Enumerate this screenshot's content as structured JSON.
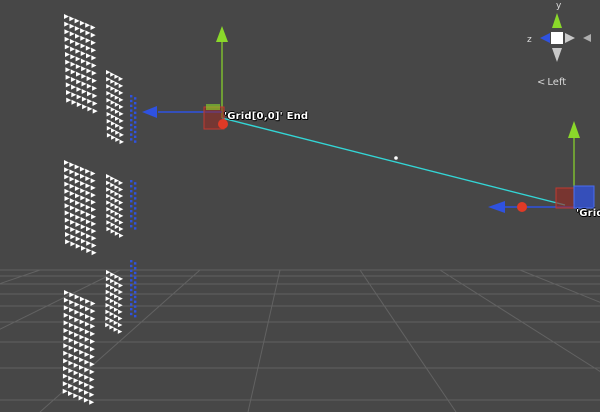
{
  "scene": {
    "label_grid_end": "'Grid[0,0]' End",
    "label_grid_start": "'Grid"
  },
  "gizmo": {
    "axis_y": "y",
    "axis_z": "z",
    "view_arrow": "<",
    "view_name": "Left"
  },
  "colors": {
    "background": "#474747",
    "floor_grid": "#626262",
    "line": "#33d6d6",
    "axis_x": "#2f52e0",
    "axis_y": "#8ad82a",
    "cube_red": "#9a2a22",
    "handle_dot": "#e03a26",
    "grid_object": "#ffffff"
  }
}
